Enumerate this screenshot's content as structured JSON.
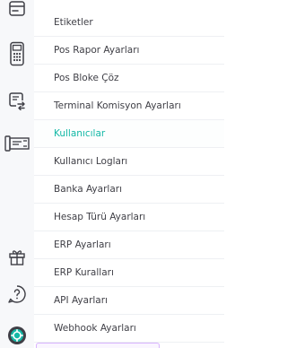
{
  "rail": {
    "items": [
      {
        "icon": "card-icon"
      },
      {
        "icon": "pos-terminal-icon"
      },
      {
        "icon": "transfer-document-icon"
      },
      {
        "icon": "cash-register-icon"
      },
      {
        "icon": "gift-icon"
      },
      {
        "icon": "help-icon"
      },
      {
        "icon": "settings-icon"
      }
    ]
  },
  "menu": {
    "active_color": "#14b8a6",
    "items": [
      {
        "label": "Etiketler"
      },
      {
        "label": "Pos Rapor Ayarları"
      },
      {
        "label": "Pos Bloke Çöz"
      },
      {
        "label": "Terminal Komisyon Ayarları"
      },
      {
        "label": "Kullanıcılar",
        "active": true
      },
      {
        "label": "Kullanıcı Logları"
      },
      {
        "label": "Banka Ayarları"
      },
      {
        "label": "Hesap Türü Ayarları"
      },
      {
        "label": "ERP Ayarları"
      },
      {
        "label": "ERP Kuralları"
      },
      {
        "label": "API Ayarları"
      },
      {
        "label": "Webhook Ayarları"
      }
    ]
  }
}
